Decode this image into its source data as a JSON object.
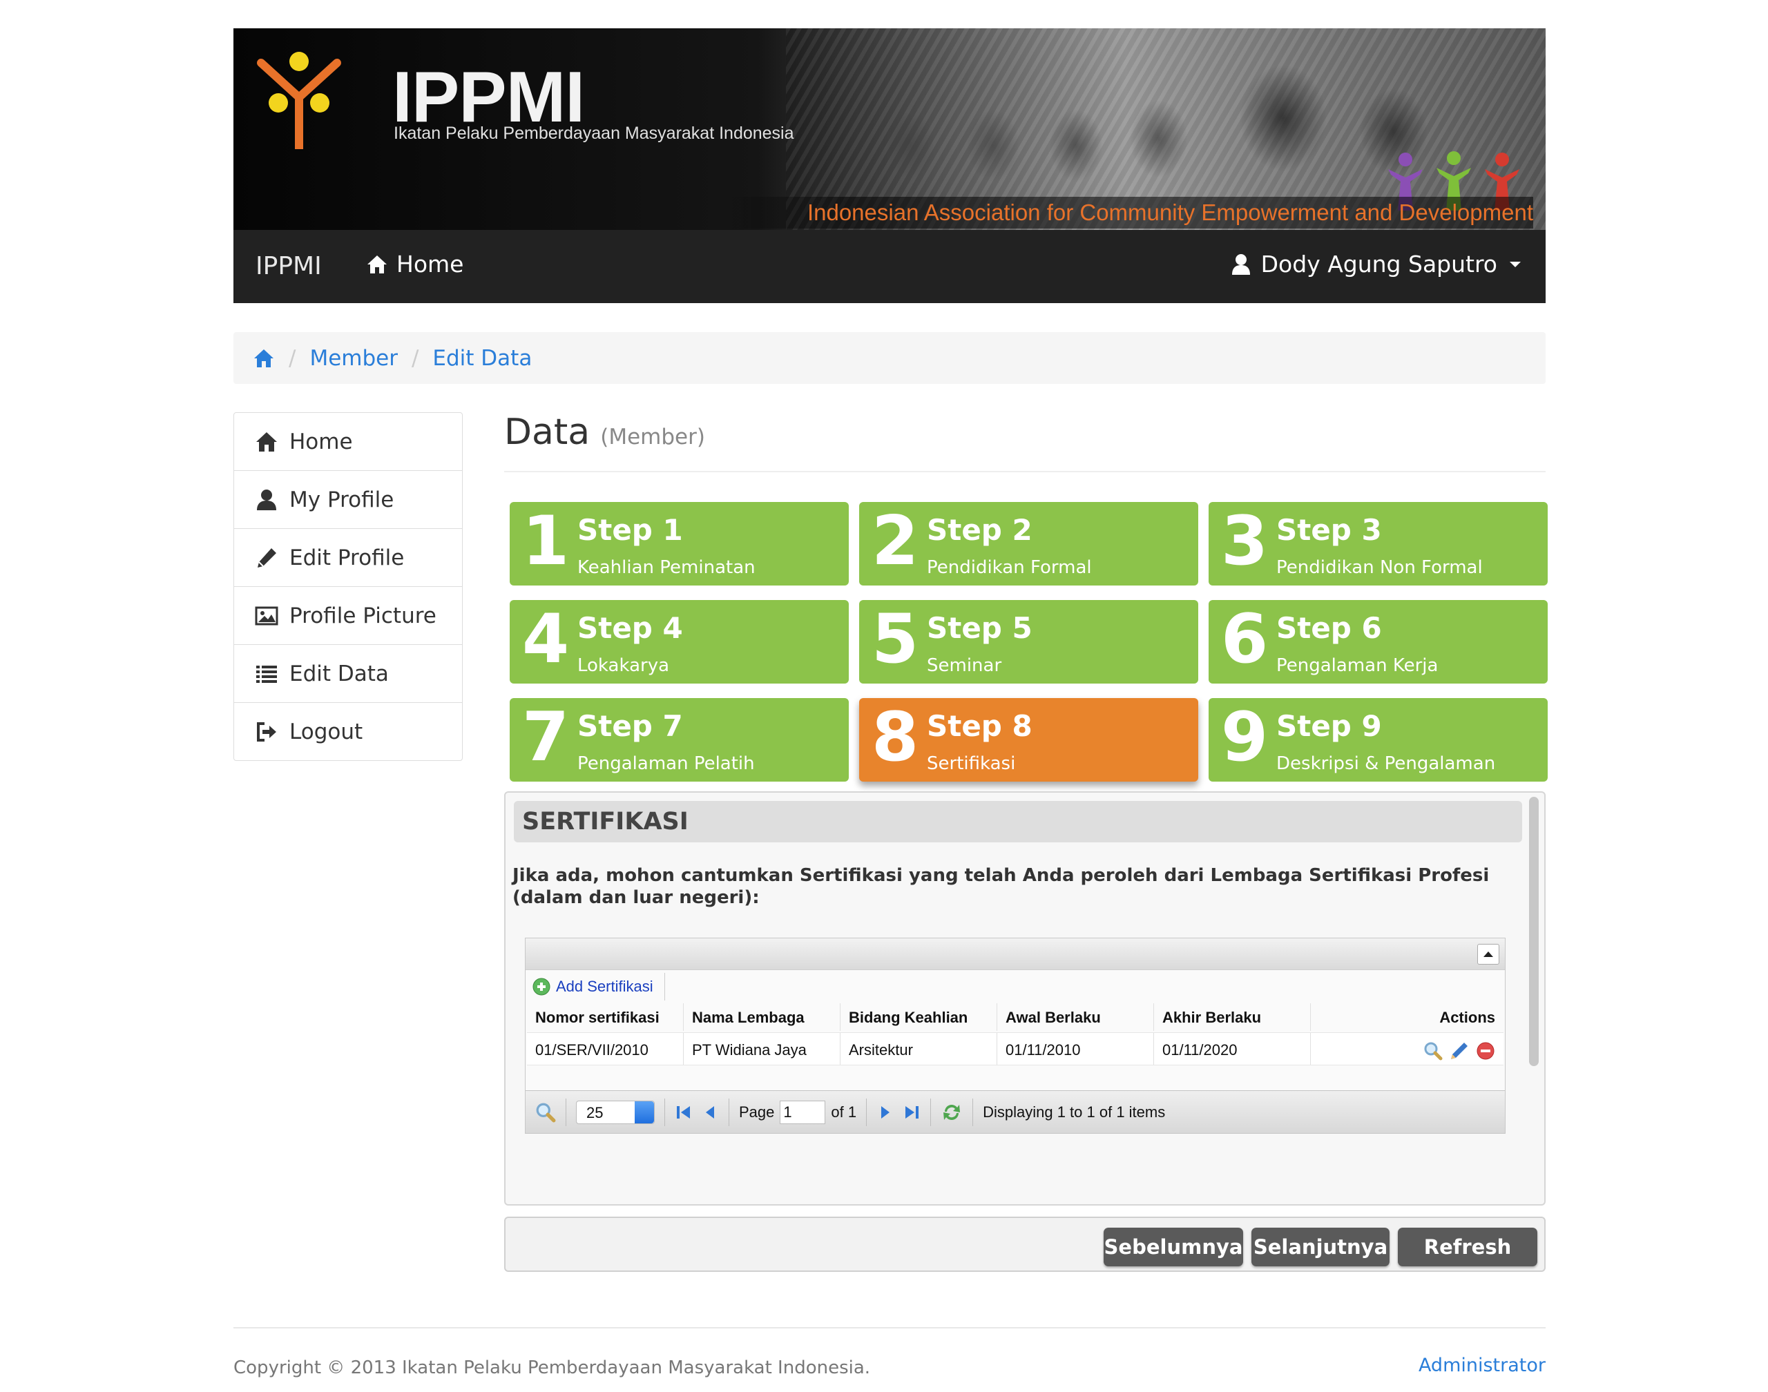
{
  "banner": {
    "brand": "IPPMI",
    "subtitle": "Ikatan Pelaku Pemberdayaan Masyarakat Indonesia",
    "caption": "Indonesian Association for Community Empowerment and Development"
  },
  "navbar": {
    "brand": "IPPMI",
    "home_label": "Home",
    "user_name": "Dody Agung Saputro"
  },
  "breadcrumb": {
    "items": [
      "Member",
      "Edit Data"
    ],
    "separator": "/"
  },
  "sidebar": {
    "items": [
      {
        "label": "Home",
        "icon": "home-icon"
      },
      {
        "label": "My Profile",
        "icon": "user-icon"
      },
      {
        "label": "Edit Profile",
        "icon": "pencil-icon"
      },
      {
        "label": "Profile Picture",
        "icon": "picture-icon"
      },
      {
        "label": "Edit Data",
        "icon": "list-icon"
      },
      {
        "label": "Logout",
        "icon": "logout-icon"
      }
    ]
  },
  "page": {
    "title": "Data",
    "subtitle": "(Member)"
  },
  "steps": [
    {
      "num": "1",
      "title": "Step 1",
      "sub": "Keahlian Peminatan",
      "active": false
    },
    {
      "num": "2",
      "title": "Step 2",
      "sub": "Pendidikan Formal",
      "active": false
    },
    {
      "num": "3",
      "title": "Step 3",
      "sub": "Pendidikan Non Formal",
      "active": false
    },
    {
      "num": "4",
      "title": "Step 4",
      "sub": "Lokakarya",
      "active": false
    },
    {
      "num": "5",
      "title": "Step 5",
      "sub": "Seminar",
      "active": false
    },
    {
      "num": "6",
      "title": "Step 6",
      "sub": "Pengalaman Kerja",
      "active": false
    },
    {
      "num": "7",
      "title": "Step 7",
      "sub": "Pengalaman Pelatih",
      "active": false
    },
    {
      "num": "8",
      "title": "Step 8",
      "sub": "Sertifikasi",
      "active": true
    },
    {
      "num": "9",
      "title": "Step 9",
      "sub": "Deskripsi & Pengalaman",
      "active": false
    }
  ],
  "section": {
    "title": "SERTIFIKASI",
    "instruction": "Jika ada, mohon cantumkan Sertifikasi yang telah Anda peroleh dari Lembaga Sertifikasi Profesi (dalam dan luar negeri):"
  },
  "grid": {
    "add_label": "Add Sertifikasi",
    "columns": [
      "Nomor sertifikasi",
      "Nama Lembaga",
      "Bidang Keahlian",
      "Awal Berlaku",
      "Akhir Berlaku",
      "Actions"
    ],
    "rows": [
      [
        "01/SER/VII/2010",
        "PT Widiana Jaya",
        "Arsitektur",
        "01/11/2010",
        "01/11/2020"
      ]
    ],
    "pager": {
      "page_size": "25",
      "page_label": "Page",
      "page_value": "1",
      "of_label": "of 1",
      "status": "Displaying 1 to 1 of 1 items"
    }
  },
  "buttons": {
    "prev": "Sebelumnya",
    "next": "Selanjutnya",
    "refresh": "Refresh"
  },
  "footer": {
    "copyright": "Copyright © 2013 Ikatan Pelaku Pemberdayaan Masyarakat Indonesia.",
    "admin": "Administrator"
  },
  "colors": {
    "step_green": "#8cc34a",
    "step_active": "#e8842c",
    "link_blue": "#2a7ed9",
    "navbar": "#222222",
    "button": "#5a5a5a"
  }
}
